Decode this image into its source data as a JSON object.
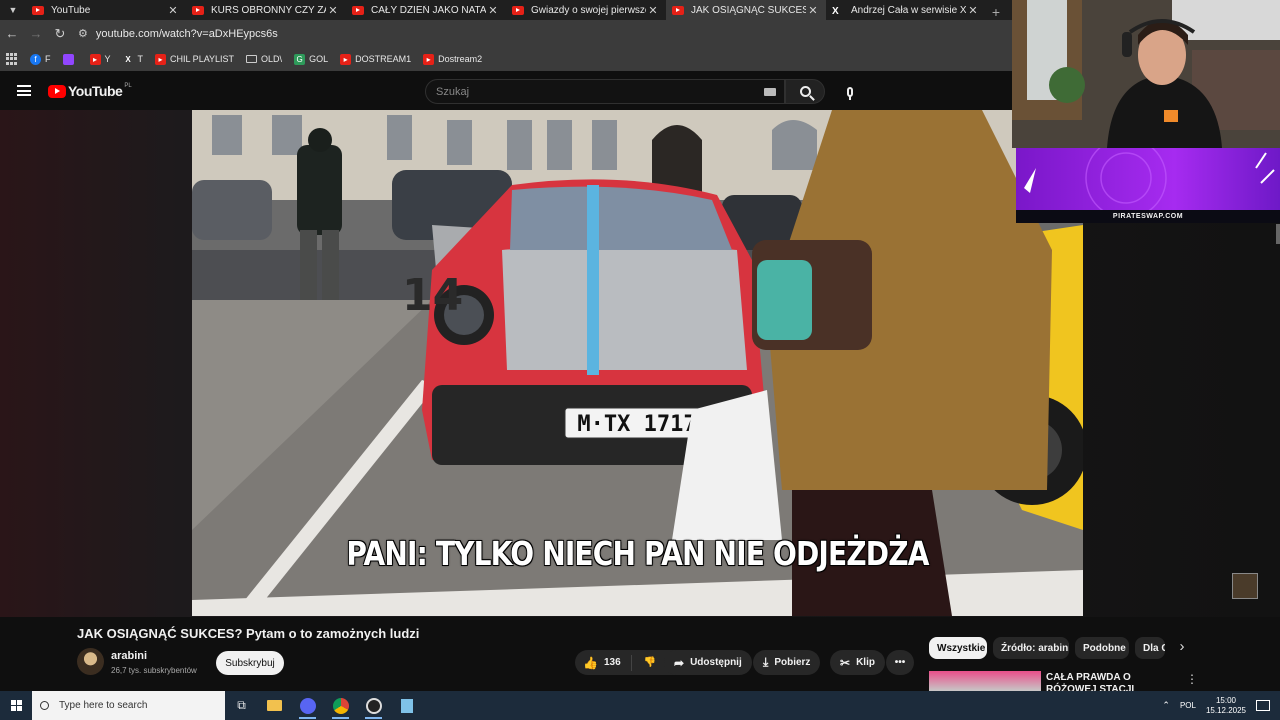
{
  "browser": {
    "tabs": [
      {
        "title": "YouTube",
        "icon": "youtube-favicon",
        "active": false
      },
      {
        "title": "KURS OBRONNY CZY ZABAWA",
        "icon": "youtube-favicon",
        "active": false
      },
      {
        "title": "CAŁY DZIEŃ JAKO NATALKA!! (",
        "icon": "youtube-favicon",
        "active": false
      },
      {
        "title": "Gwiazdy o swojej pierwszej pra",
        "icon": "youtube-favicon",
        "active": false
      },
      {
        "title": "JAK OSIĄGNĄĆ SUKCES? Pytam",
        "icon": "youtube-favicon",
        "active": true
      },
      {
        "title": "Andrzej Cała w serwisie X: „ja ju",
        "icon": "x-favicon",
        "active": false
      }
    ],
    "url": "youtube.com/watch?v=aDxHEypcs6s",
    "bookmarks": [
      {
        "label": "F",
        "icon": "facebook-icon"
      },
      {
        "label": "",
        "icon": "twitch-icon"
      },
      {
        "label": "Y",
        "icon": "youtube-icon"
      },
      {
        "label": "T",
        "icon": "x-icon"
      },
      {
        "label": "CHIL PLAYLIST",
        "icon": "youtube-icon"
      },
      {
        "label": "OLD\\",
        "icon": "folder-icon"
      },
      {
        "label": "GOL",
        "icon": "gol-icon"
      },
      {
        "label": "DOSTREAM1",
        "icon": "youtube-icon"
      },
      {
        "label": "Dostream2",
        "icon": "youtube-icon"
      }
    ]
  },
  "youtube": {
    "logo_text": "YouTube",
    "country_code": "PL",
    "search_placeholder": "Szukaj",
    "subtitle": "PANI: TYLKO NIECH PAN NIE ODJEŻDŻA",
    "plate": "M·TX 1717",
    "car_number": "14",
    "video_title": "JAK OSIĄGNĄĆ SUKCES? Pytam o to zamożnych ludzi",
    "channel": {
      "name": "arabini",
      "subscribers": "26,7 tys. subskrybentów"
    },
    "subscribe_label": "Subskrybuj",
    "likes": "136",
    "share_label": "Udostępnij",
    "download_label": "Pobierz",
    "clip_label": "Klip",
    "chips": [
      "Wszystkie",
      "Źródło: arabini",
      "Podobne",
      "Dla C"
    ],
    "recommended": {
      "title": "CAŁA PRAWDA O RÓŻOWEJ STACJI SKOLIMA -"
    }
  },
  "stream": {
    "sponsor": "PIRATESWAP.COM"
  },
  "taskbar": {
    "search_placeholder": "Type here to search",
    "language": "POL",
    "time": "15:00",
    "date": "15.12.2025"
  },
  "colors": {
    "yt_red": "#ff0000",
    "accent_purple": "#a62bf0",
    "taskbar": "#1c2b3b"
  }
}
